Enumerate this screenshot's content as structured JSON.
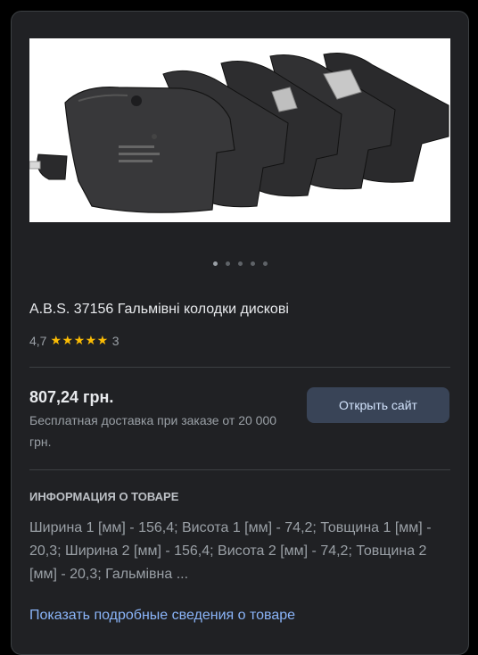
{
  "product": {
    "title": "A.B.S. 37156 Гальмівні колодки дискові",
    "image_alt": "brake pads",
    "carousel_total": 5,
    "carousel_active": 1
  },
  "rating": {
    "score": "4,7",
    "stars_value": 4.7,
    "count": "3"
  },
  "offer": {
    "price": "807,24 грн.",
    "delivery": "Бесплатная доставка при заказе от 20 000 грн.",
    "button_label": "Открыть сайт"
  },
  "info": {
    "heading": "ИНФОРМАЦИЯ О ТОВАРЕ",
    "text": "Ширина 1 [мм] - 156,4; Висота 1 [мм] - 74,2; Товщина 1 [мм] - 20,3; Ширина 2 [мм] - 156,4; Висота 2 [мм] - 74,2; Товщина 2 [мм] - 20,3; Гальмівна ...",
    "more_link": "Показать подробные сведения о товаре"
  },
  "colors": {
    "card_bg": "#202124",
    "accent_link": "#8ab4f8",
    "star": "#fbbc04",
    "button_bg": "#394457"
  }
}
